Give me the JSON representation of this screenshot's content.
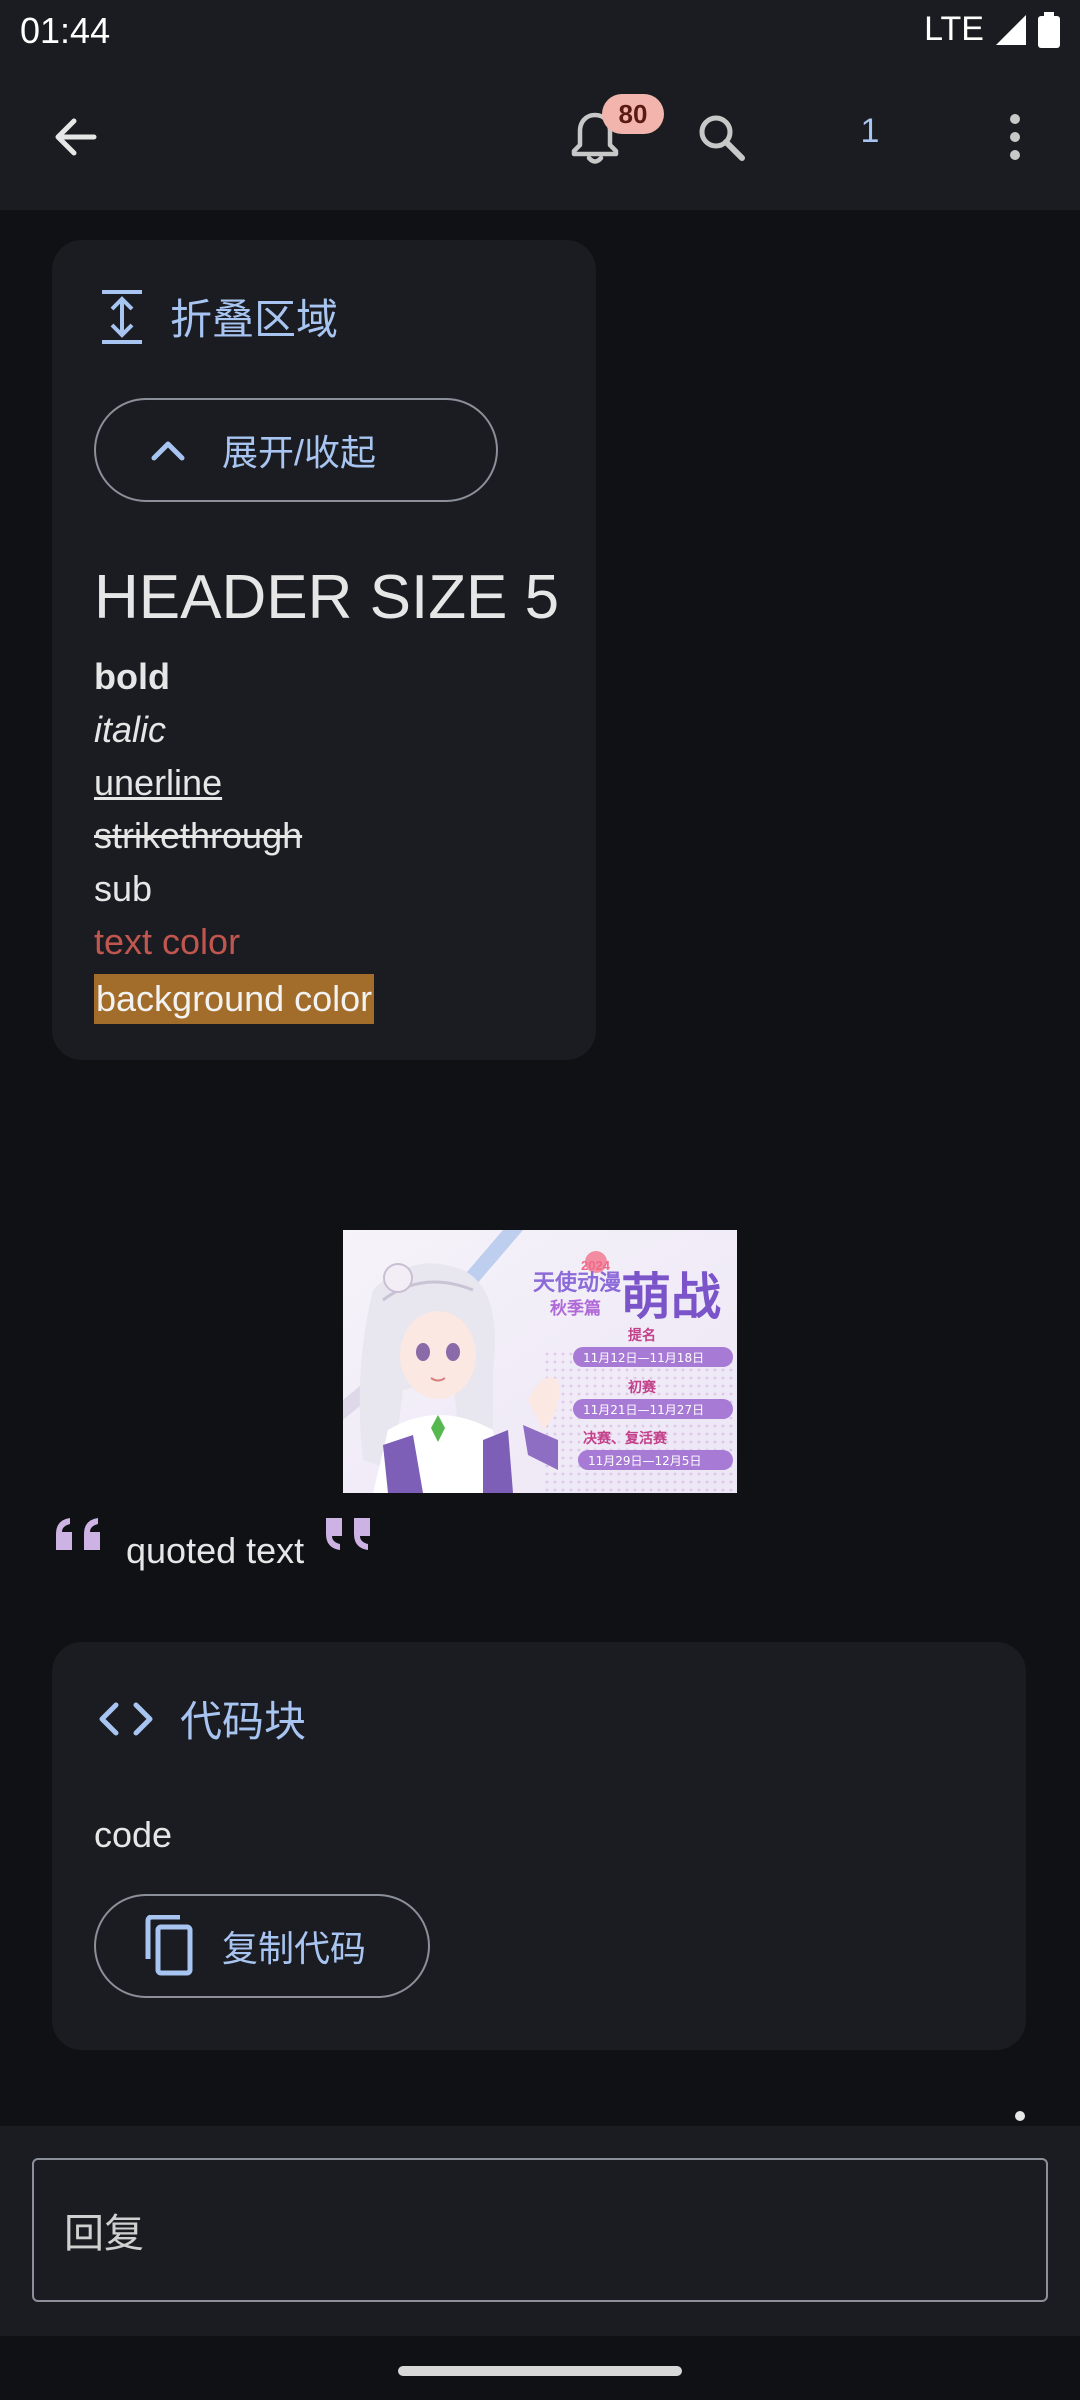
{
  "status_bar": {
    "time": "01:44",
    "network": "LTE"
  },
  "app_bar": {
    "notification_count": "80",
    "page_number": "1"
  },
  "collapse": {
    "title": "折叠区域",
    "toggle_label": "展开/收起",
    "header": "HEADER SIZE 5",
    "bold": "bold",
    "italic": "italic",
    "underline": "unerline",
    "strikethrough": "strikethrough",
    "sub": "sub",
    "text_color": "text color",
    "background_color": "background color",
    "text_color_value": "#c0564e",
    "background_color_value": "#a26d2a"
  },
  "image": {
    "year": "2024",
    "line1": "天使动漫",
    "line2": "秋季篇",
    "big": "萌战",
    "label1": "提名",
    "date1": "11月12日—11月18日",
    "label2": "初赛",
    "date2": "11月21日—11月27日",
    "label3": "决赛、复活赛",
    "date3": "11月29日—12月5日"
  },
  "quote": {
    "text": "quoted text"
  },
  "code_block": {
    "title": "代码块",
    "code": "code",
    "copy_label": "复制代码"
  },
  "reply": {
    "placeholder": "回复"
  },
  "colors": {
    "accent": "#a8c4f0",
    "badge": "#f2b5ad",
    "quote_marks": "#cdb3e3"
  }
}
